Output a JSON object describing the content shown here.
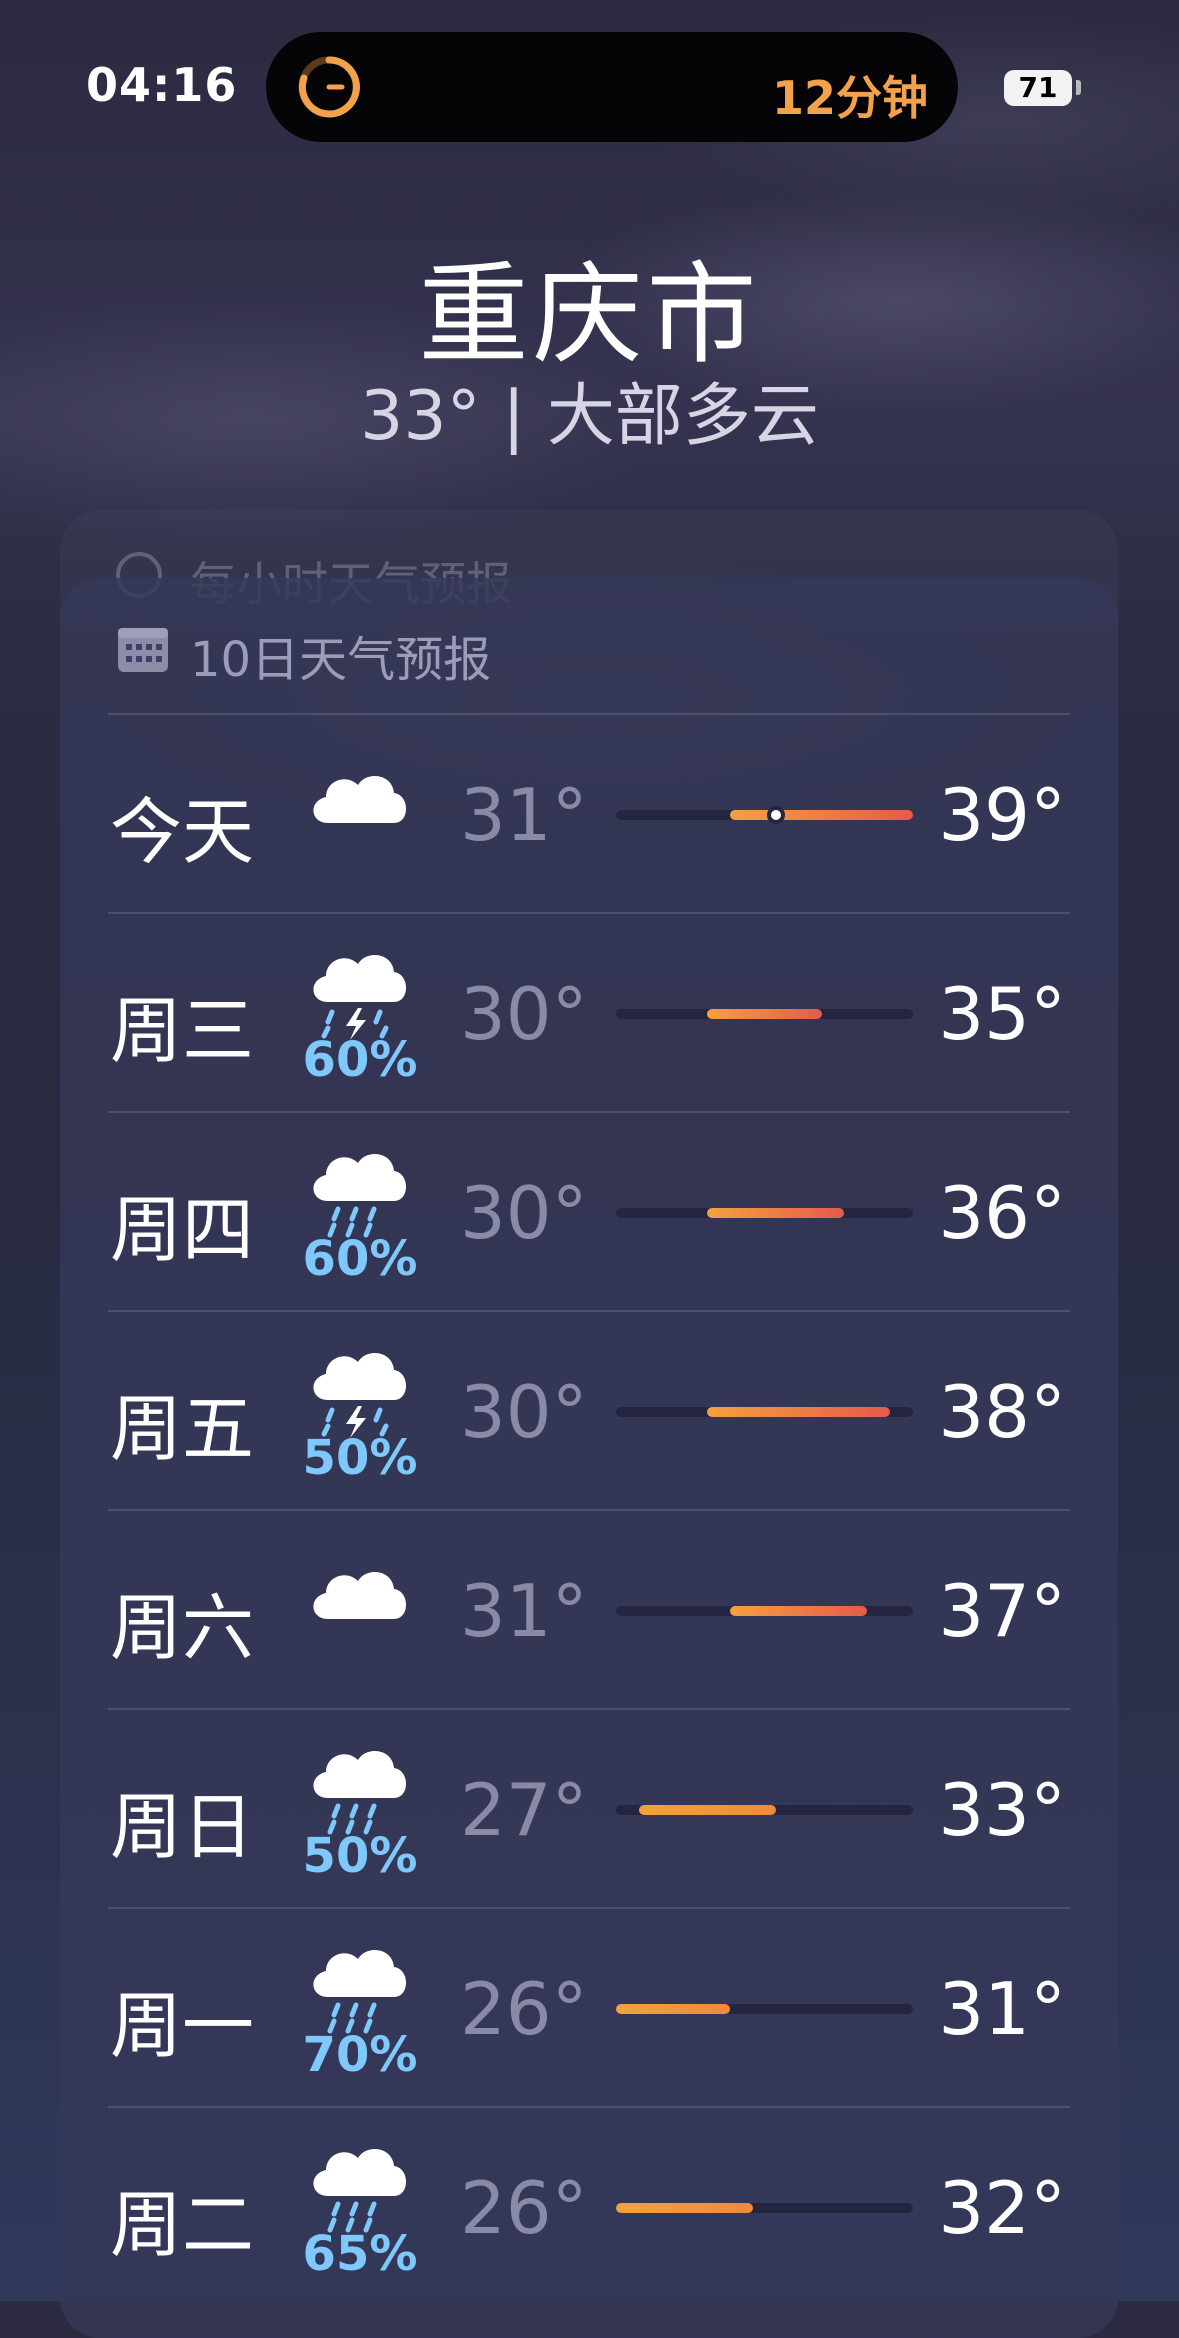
{
  "status_bar": {
    "time": "04:16",
    "timer_text": "12分钟",
    "battery": "71"
  },
  "location": {
    "city": "重庆市",
    "condition": "33° | 大部多云"
  },
  "hourly": {
    "title": "每小时天气预报"
  },
  "forecast": {
    "title": "10日天气预报",
    "colors": {
      "orange": "#f4a13e",
      "red": "#e65a4c",
      "precip": "#7ec8fb"
    },
    "days": [
      {
        "day": "今天",
        "icon": "cloud-icon",
        "prob": "",
        "low": "31°",
        "high": "39°",
        "range_from": 31,
        "range_to": 39,
        "current": 33
      },
      {
        "day": "周三",
        "icon": "thunderstorm-icon",
        "prob": "60%",
        "low": "30°",
        "high": "35°",
        "range_from": 30,
        "range_to": 35
      },
      {
        "day": "周四",
        "icon": "rain-icon",
        "prob": "60%",
        "low": "30°",
        "high": "36°",
        "range_from": 30,
        "range_to": 36
      },
      {
        "day": "周五",
        "icon": "thunderstorm-icon",
        "prob": "50%",
        "low": "30°",
        "high": "38°",
        "range_from": 30,
        "range_to": 38
      },
      {
        "day": "周六",
        "icon": "cloud-icon",
        "prob": "",
        "low": "31°",
        "high": "37°",
        "range_from": 31,
        "range_to": 37
      },
      {
        "day": "周日",
        "icon": "rain-icon",
        "prob": "50%",
        "low": "27°",
        "high": "33°",
        "range_from": 27,
        "range_to": 33
      },
      {
        "day": "周一",
        "icon": "rain-icon",
        "prob": "70%",
        "low": "26°",
        "high": "31°",
        "range_from": 26,
        "range_to": 31
      },
      {
        "day": "周二",
        "icon": "rain-icon",
        "prob": "65%",
        "low": "26°",
        "high": "32°",
        "range_from": 26,
        "range_to": 32
      }
    ]
  }
}
